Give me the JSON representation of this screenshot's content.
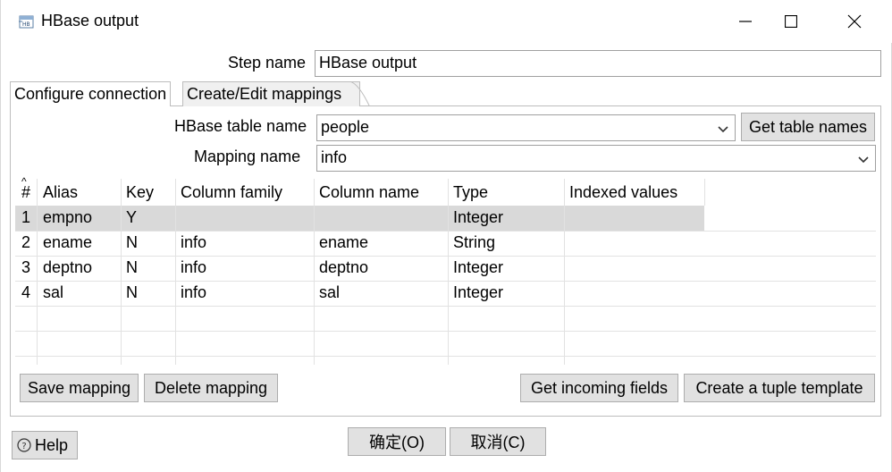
{
  "window": {
    "title": "HBase output"
  },
  "step": {
    "label": "Step name",
    "value": "HBase output"
  },
  "tabs": [
    {
      "label": "Configure connection"
    },
    {
      "label": "Create/Edit mappings"
    }
  ],
  "mapping_tab": {
    "table_name_label": "HBase table name",
    "table_name_value": "people",
    "get_table_names_label": "Get table names",
    "mapping_name_label": "Mapping name",
    "mapping_name_value": "info"
  },
  "grid": {
    "sort_glyph": "^",
    "columns": [
      "#",
      "Alias",
      "Key",
      "Column family",
      "Column name",
      "Type",
      "Indexed values"
    ],
    "rows": [
      [
        "1",
        "empno",
        "Y",
        "",
        "",
        "Integer",
        ""
      ],
      [
        "2",
        "ename",
        "N",
        "info",
        "ename",
        "String",
        ""
      ],
      [
        "3",
        "deptno",
        "N",
        "info",
        "deptno",
        "Integer",
        ""
      ],
      [
        "4",
        "sal",
        "N",
        "info",
        "sal",
        "Integer",
        ""
      ]
    ]
  },
  "buttons": {
    "save_mapping": "Save mapping",
    "delete_mapping": "Delete mapping",
    "get_incoming_fields": "Get incoming fields",
    "create_tuple_template": "Create a tuple template",
    "help": "Help",
    "ok": "确定(O)",
    "cancel": "取消(C)"
  },
  "colors": {
    "selected_row": "#d9d9d9",
    "button_face": "#e1e1e1"
  }
}
